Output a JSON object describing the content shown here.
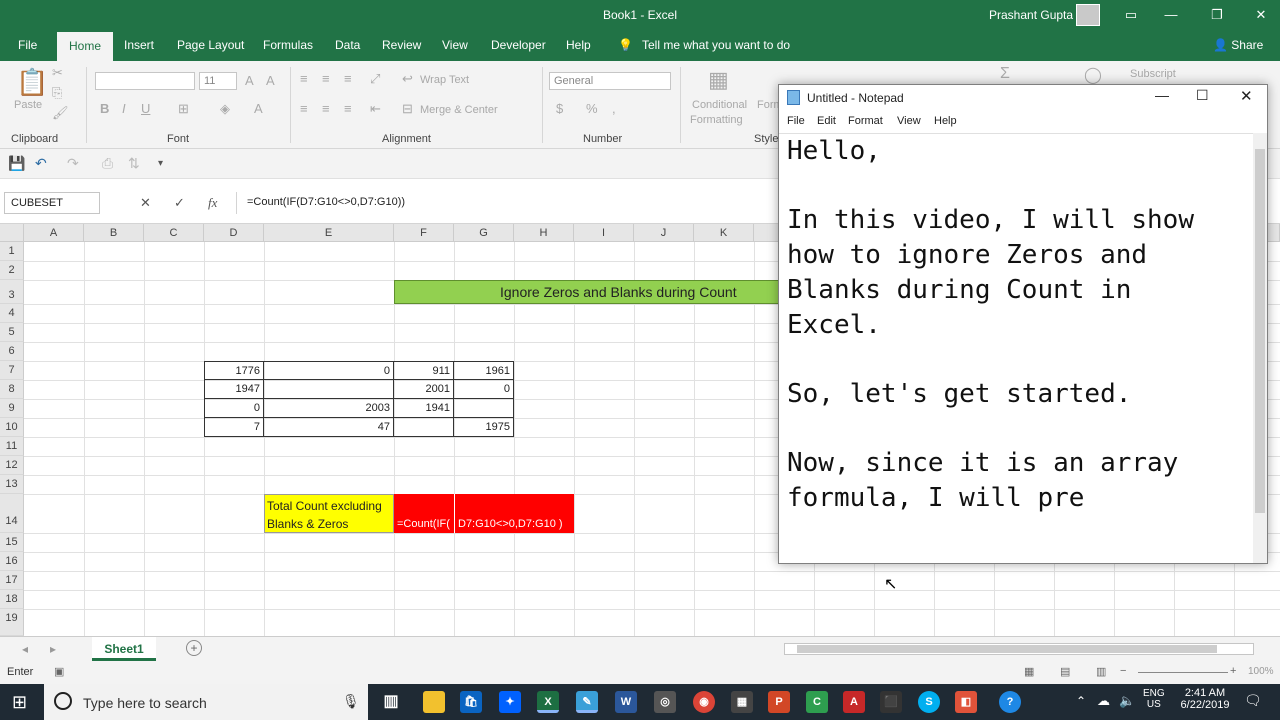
{
  "window": {
    "title": "Book1  -  Excel",
    "user": "Prashant Gupta"
  },
  "ribbon": {
    "tabs": [
      "File",
      "Home",
      "Insert",
      "Page Layout",
      "Formulas",
      "Data",
      "Review",
      "View",
      "Developer",
      "Help"
    ],
    "tell_me": "Tell me what you want to do",
    "share": "Share",
    "font_size": "11",
    "number_format": "General",
    "groups": {
      "clipboard": "Clipboard",
      "font": "Font",
      "alignment": "Alignment",
      "number": "Number",
      "styles": "Style"
    },
    "labels": {
      "paste": "Paste",
      "wrap_text": "Wrap Text",
      "merge_center": "Merge & Center",
      "conditional": "Conditional",
      "formatting": "Formatting",
      "format_partial": "Form",
      "subscript": "Subscript"
    }
  },
  "formula_bar": {
    "name_box": "CUBESET",
    "formula": "=Count(IF(D7:G10<>0,D7:G10))"
  },
  "grid": {
    "columns": [
      "A",
      "B",
      "C",
      "D",
      "E",
      "F",
      "G",
      "H",
      "I",
      "J",
      "K"
    ],
    "rows": [
      "1",
      "2",
      "3",
      "4",
      "5",
      "6",
      "7",
      "8",
      "9",
      "10",
      "11",
      "12",
      "13",
      "14",
      "15",
      "16",
      "17",
      "18",
      "19",
      "20"
    ],
    "banner": "Ignore Zeros and Blanks during Count",
    "table": [
      [
        "1776",
        "0",
        "911",
        "1961"
      ],
      [
        "1947",
        "",
        "2001",
        "0"
      ],
      [
        "0",
        "2003",
        "1941",
        ""
      ],
      [
        "7",
        "47",
        "",
        "1975"
      ]
    ],
    "label_line1": "Total Count excluding",
    "label_line2": "Blanks & Zeros",
    "formula_cell_a": "=Count(IF(",
    "formula_cell_b": "D7:G10<>0,D7:G10 )",
    "colors": {
      "banner": "#92d050",
      "label": "#ffff00",
      "formula": "#ff0000"
    }
  },
  "sheets": {
    "active": "Sheet1"
  },
  "status": {
    "mode": "Enter",
    "zoom": "100%"
  },
  "taskbar": {
    "search_placeholder": "Type here to search",
    "lang1": "ENG",
    "lang2": "US",
    "time": "2:41 AM",
    "date": "6/22/2019"
  },
  "notepad": {
    "title": "Untitled - Notepad",
    "menu": [
      "File",
      "Edit",
      "Format",
      "View",
      "Help"
    ],
    "text": "Hello,\n\nIn this video, I will show\nhow to ignore Zeros and\nBlanks during Count in\nExcel.\n\nSo, let's get started.\n\nNow, since it is an array\nformula, I will pre"
  }
}
